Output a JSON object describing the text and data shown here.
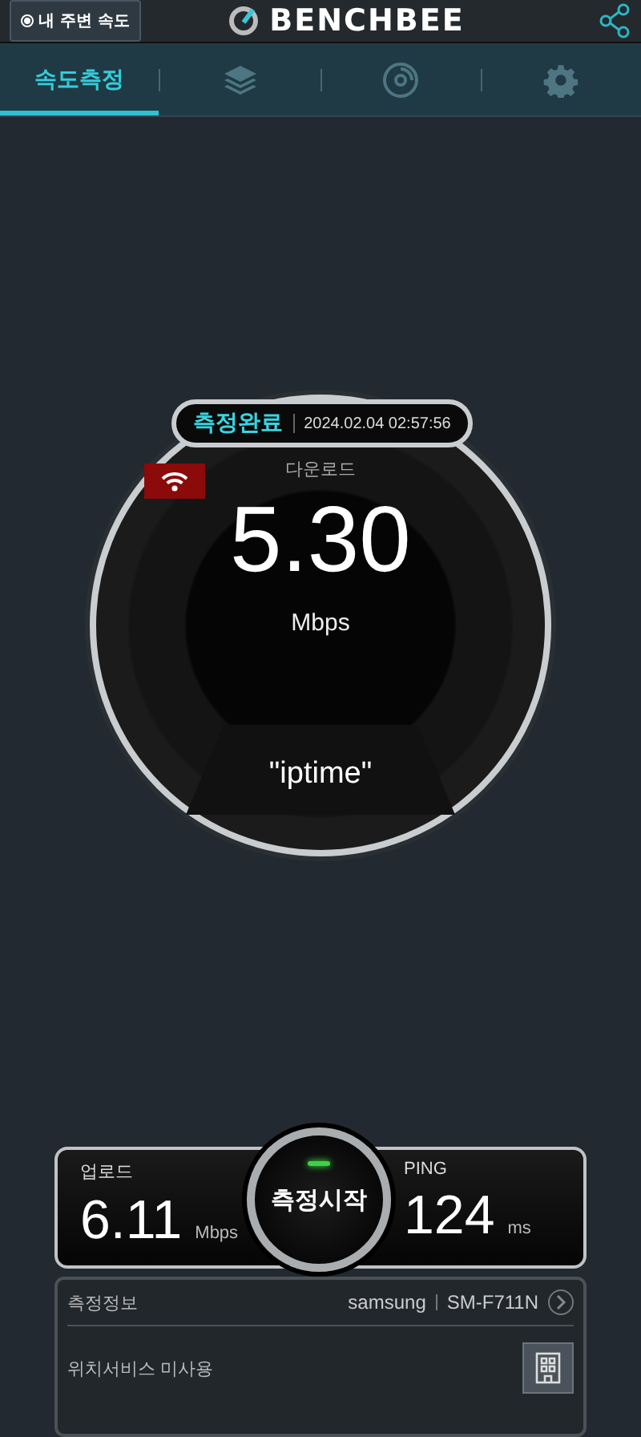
{
  "header": {
    "nearby_button": "내 주변 속도",
    "logo": "BENCHBEE"
  },
  "tabs": [
    {
      "kind": "text",
      "label": "속도측정",
      "selected": true
    },
    {
      "kind": "layers",
      "selected": false
    },
    {
      "kind": "disc",
      "selected": false
    },
    {
      "kind": "gear",
      "selected": false
    }
  ],
  "gauge": {
    "status": "측정완료",
    "timestamp": "2024.02.04 02:57:56",
    "download_label": "다운로드",
    "download_value": "5.30",
    "download_unit": "Mbps",
    "network_name": "\"iptime\""
  },
  "upload": {
    "label": "업로드",
    "value": "6.11",
    "unit": "Mbps"
  },
  "start_button": "측정시작",
  "ping": {
    "label": "PING",
    "value": "124",
    "unit": "ms"
  },
  "info": {
    "label": "측정정보",
    "maker": "samsung",
    "model": "SM-F711N",
    "location": "위치서비스 미사용"
  }
}
